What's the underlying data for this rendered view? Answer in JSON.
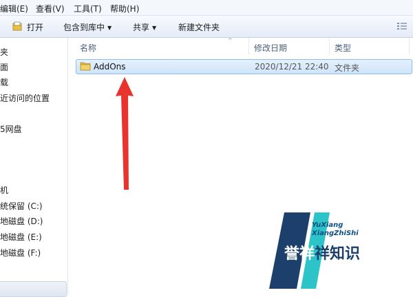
{
  "menu": {
    "items": [
      "编辑(E)",
      "查看(V)",
      "工具(T)",
      "帮助(H)"
    ]
  },
  "toolbar": {
    "open_label": "打开",
    "include_library_label": "包含到库中",
    "share_label": "共享",
    "new_folder_label": "新建文件夹",
    "caret": "▼"
  },
  "nav": {
    "items": [
      "夹",
      "面",
      "载",
      "近访问的位置",
      "5网盘",
      "机",
      "统保留 (C:)",
      "地磁盘 (D:)",
      "地磁盘 (E:)",
      "地磁盘 (F:)"
    ]
  },
  "columns": {
    "name": "名称",
    "modified": "修改日期",
    "type": "类型",
    "sort_glyph": "^"
  },
  "files": [
    {
      "name": "AddOns",
      "modified": "2020/12/21 22:40",
      "type": "文件夹"
    }
  ],
  "annotation": {
    "color": "#e8332e"
  },
  "watermark": {
    "line1": "YuXiang",
    "line2": "XiangZhiShi",
    "chinese_part1": "誉祥",
    "chinese_part2": "祥知识",
    "dark": "#1c3f6b",
    "teal": "#2cc3c9"
  },
  "icons": [
    "open-icon",
    "view-options-icon",
    "folder-icon",
    "sort-up-icon"
  ]
}
